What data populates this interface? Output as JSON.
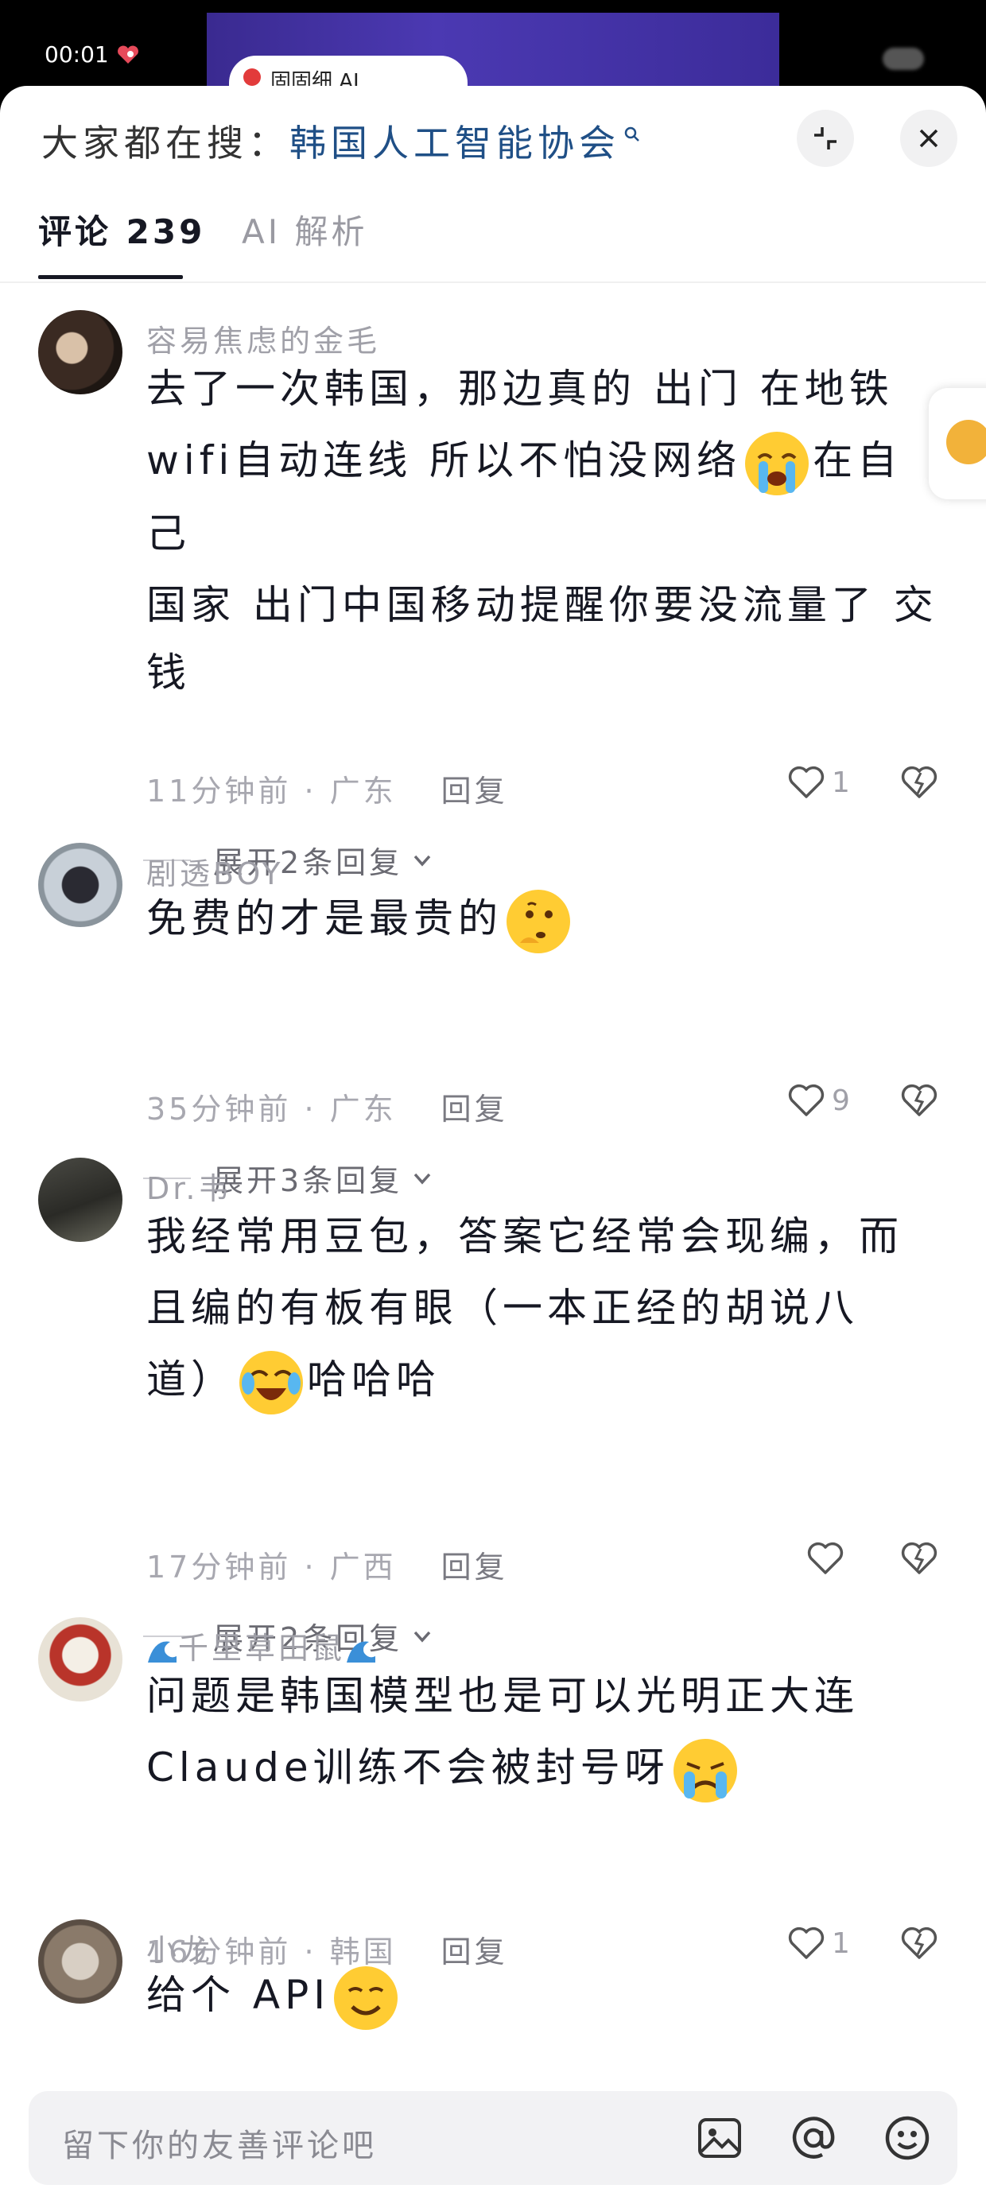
{
  "status_bar": {
    "time": "00:01"
  },
  "video": {
    "pill_text": "固固细 AI"
  },
  "header": {
    "search_prefix": "大家都在搜：",
    "search_keyword": "韩国人工智能协会",
    "search_icon": "magnifier-icon",
    "collapse_icon": "collapse-icon",
    "close_icon": "close-icon"
  },
  "tabs": [
    {
      "label": "评论 239"
    },
    {
      "label": "AI 解析"
    }
  ],
  "comments": [
    {
      "username": "容易焦虑的金毛",
      "content_lines": [
        "去了一次韩国，那边真的 出门 在地铁",
        "wifi自动连线 所以不怕没网络",
        "在自己",
        "国家 出门中国移动提醒你要没流量了 交",
        "钱"
      ],
      "time": "11分钟前",
      "location": "广东",
      "reply_label": "回复",
      "likes": "1",
      "expand_label": "展开2条回复"
    },
    {
      "username": "剧透BOY",
      "content": "免费的才是最贵的",
      "time": "35分钟前",
      "location": "广东",
      "reply_label": "回复",
      "likes": "9",
      "expand_label": "展开3条回复"
    },
    {
      "username": "Dr.韦",
      "content_lines": [
        "我经常用豆包，答案它经常会现编，而",
        "且编的有板有眼（一本正经的胡说八",
        "道）",
        "哈哈哈"
      ],
      "time": "17分钟前",
      "location": "广西",
      "reply_label": "回复",
      "likes": "",
      "expand_label": "展开2条回复"
    },
    {
      "username": "千里草田鼠",
      "content_lines": [
        "问题是韩国模型也是可以光明正大连",
        "Claude训练不会被封号呀"
      ],
      "time": "16分钟前",
      "location": "韩国",
      "reply_label": "回复",
      "likes": "1"
    },
    {
      "username": "小龙",
      "content": "给个 API"
    }
  ],
  "input": {
    "placeholder": "留下你的友善评论吧",
    "icons": [
      "image-icon",
      "at-icon",
      "emoji-icon"
    ]
  },
  "colors": {
    "keyword": "#1f4f86",
    "meta_text": "#a8a8b0",
    "primary_text": "#161823"
  }
}
